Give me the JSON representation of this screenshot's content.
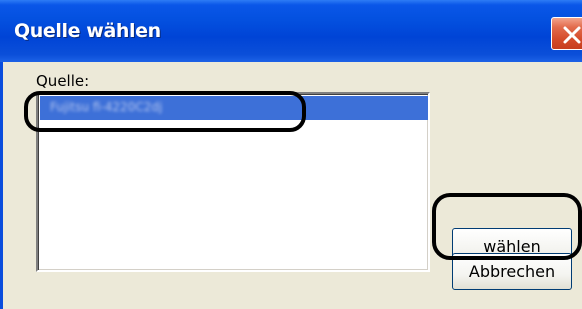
{
  "window": {
    "title": "Quelle wählen",
    "close_icon": "close-icon"
  },
  "source": {
    "label": "Quelle:",
    "items": [
      {
        "label": "Fujitsu fi-4220C2dj",
        "selected": true
      }
    ]
  },
  "buttons": {
    "select_label": "wählen",
    "cancel_label": "Abbrechen"
  },
  "colors": {
    "titlebar": "#0451e0",
    "selection": "#3d70d8",
    "dialog_bg": "#ece9d8",
    "close_button": "#d44a29",
    "annotation": "#000000"
  }
}
